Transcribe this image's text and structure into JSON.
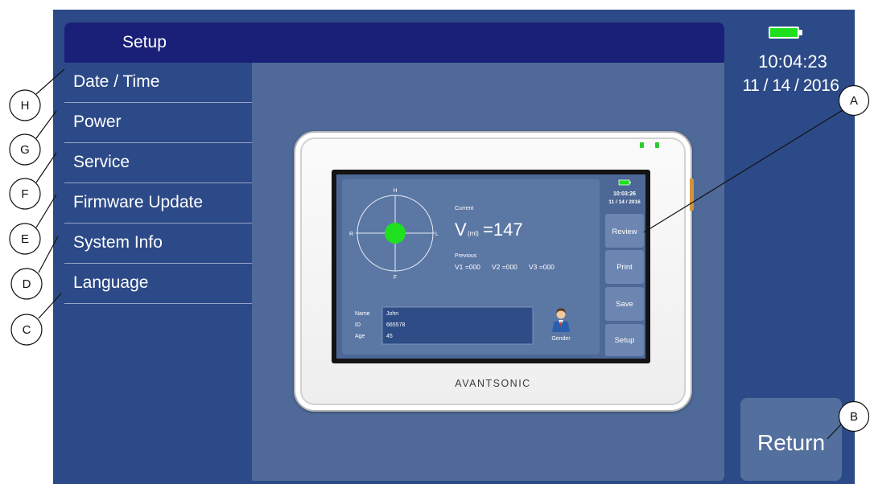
{
  "app": {
    "header": {
      "title": "Setup"
    },
    "menu": {
      "items": [
        {
          "label": "Date / Time"
        },
        {
          "label": "Power"
        },
        {
          "label": "Service"
        },
        {
          "label": "Firmware Update"
        },
        {
          "label": "System Info"
        },
        {
          "label": "Language"
        }
      ]
    },
    "status": {
      "battery_icon": "battery-full-icon",
      "time": "10:04:23",
      "date": "11 / 14 / 2016"
    },
    "return_button": {
      "label": "Return"
    }
  },
  "device_preview": {
    "brand": "AVANTSONIC",
    "screen": {
      "crosshair": {
        "top": "H",
        "left": "R",
        "right": "L",
        "bottom": "F"
      },
      "current_label": "Current",
      "volume": {
        "symbol": "V",
        "unit": "(ml)",
        "value": "=147"
      },
      "previous_label": "Previous",
      "previous": [
        "V1 =000",
        "V2 =000",
        "V3 =000"
      ],
      "patient": {
        "name_label": "Name",
        "name": "John",
        "id_label": "ID",
        "id": "665578",
        "age_label": "Age",
        "age": "45",
        "gender_icon": "person-icon",
        "gender_label": "Gender"
      },
      "battery_icon": "battery-full-icon",
      "time": "10:03:26",
      "date": "11 / 14 / 2016",
      "buttons": [
        {
          "label": "Review"
        },
        {
          "label": "Print"
        },
        {
          "label": "Save"
        },
        {
          "label": "Setup"
        }
      ]
    }
  },
  "callouts": [
    {
      "label": "A"
    },
    {
      "label": "B"
    },
    {
      "label": "C"
    },
    {
      "label": "D"
    },
    {
      "label": "E"
    },
    {
      "label": "F"
    },
    {
      "label": "G"
    },
    {
      "label": "H"
    }
  ],
  "colors": {
    "frame": "#2c4a87",
    "header": "#1a2078",
    "content": "#4f6a98",
    "button": "#536f9d",
    "battery": "#1fe01f"
  }
}
